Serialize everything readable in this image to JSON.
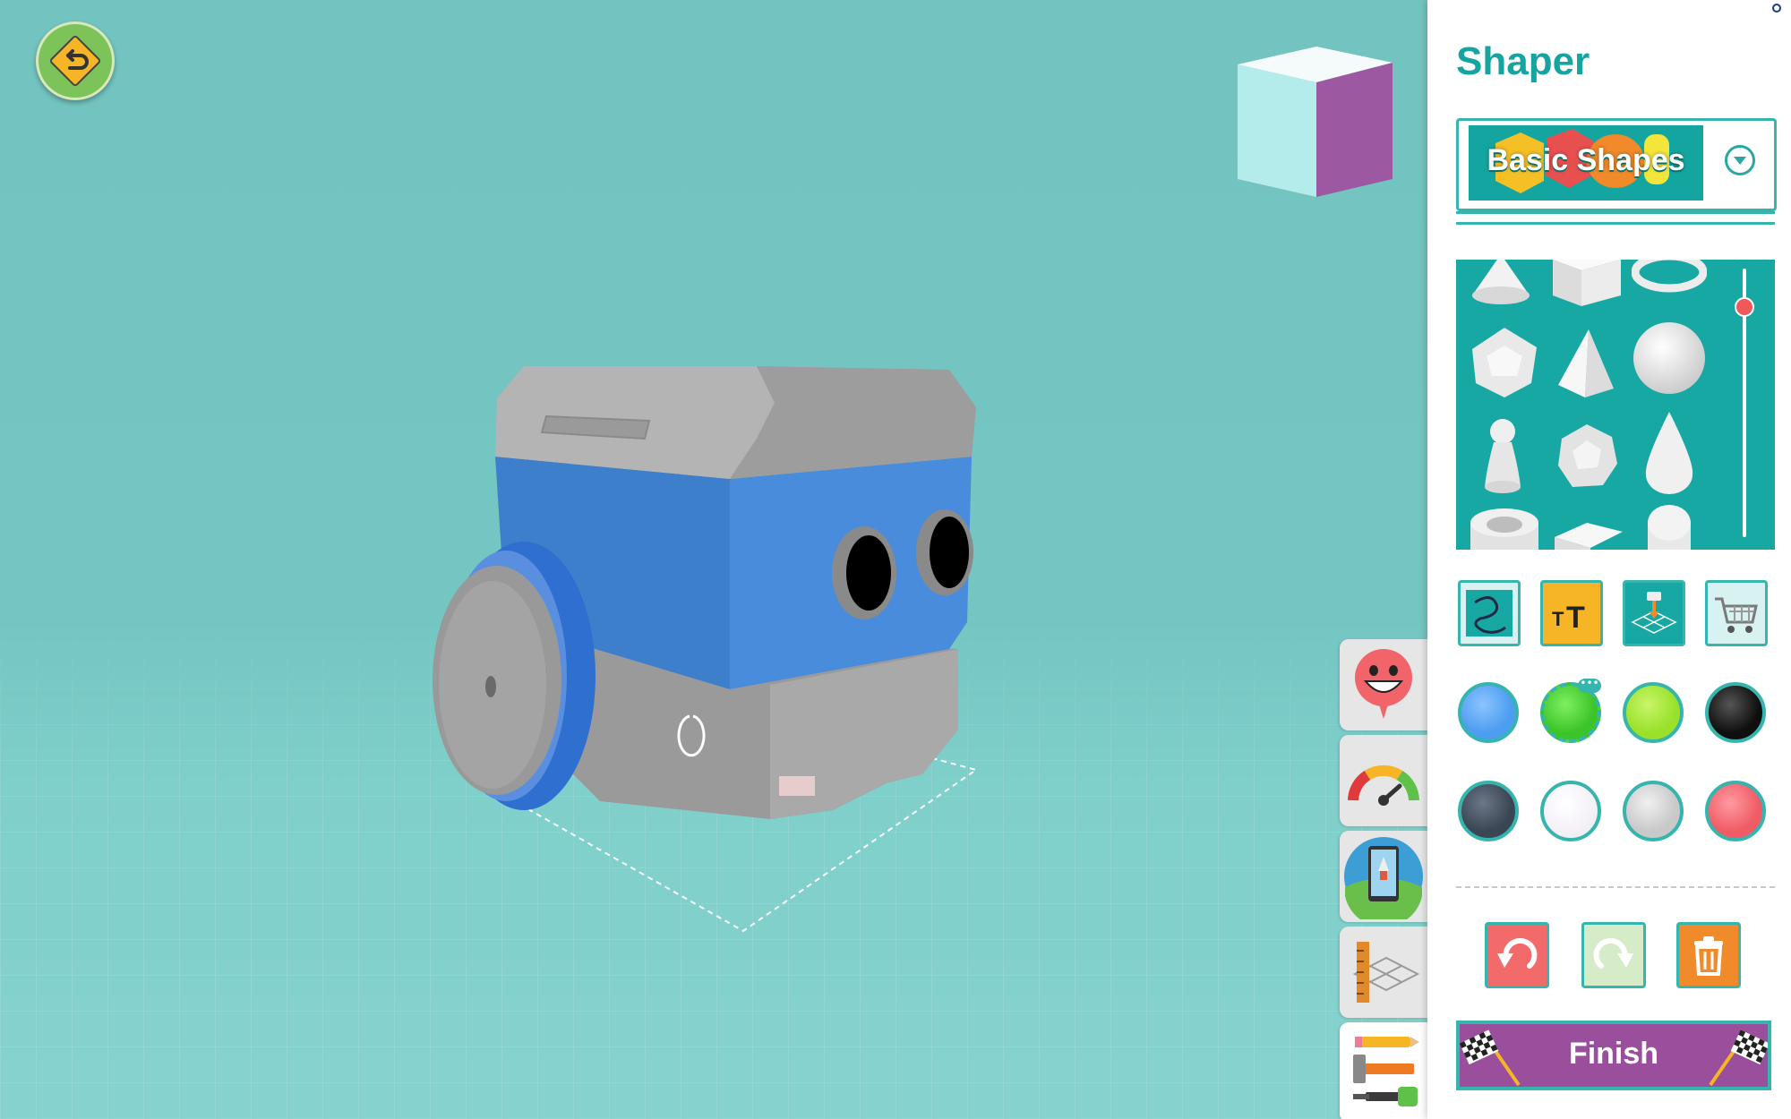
{
  "panel": {
    "title": "Shaper",
    "category": {
      "label": "Basic Shapes"
    },
    "shapes": [
      "cone-shape",
      "cube-shape",
      "torus-shape",
      "dodecahedron-shape",
      "pyramid-shape",
      "sphere-shape",
      "pawn-shape",
      "geodesic-sphere-shape",
      "teardrop-shape",
      "tube-shape",
      "wedge-shape",
      "capsule-shape"
    ],
    "tools": [
      "squiggle-path-icon",
      "text-icon",
      "import-icon",
      "shopping-cart-icon"
    ],
    "colors": [
      {
        "name": "blue",
        "hex": "#4d9df0"
      },
      {
        "name": "green",
        "hex": "#3ec42b",
        "selected": true
      },
      {
        "name": "lime",
        "hex": "#99e12a"
      },
      {
        "name": "black",
        "hex": "#0f0f0f"
      },
      {
        "name": "dark-gray",
        "hex": "#3b4654"
      },
      {
        "name": "white",
        "hex": "#ffffff"
      },
      {
        "name": "light-gray",
        "hex": "#c9c9c9"
      },
      {
        "name": "red",
        "hex": "#f05c66"
      }
    ],
    "actions": [
      "undo-icon",
      "redo-icon",
      "trash-icon"
    ],
    "finish_label": "Finish"
  },
  "tool_tabs": [
    "emoji-face-icon",
    "speedometer-icon",
    "tablet-rocket-icon",
    "ruler-grid-icon",
    "pencil-hammer-screwdriver-icon"
  ],
  "accent": "#36b4ae"
}
